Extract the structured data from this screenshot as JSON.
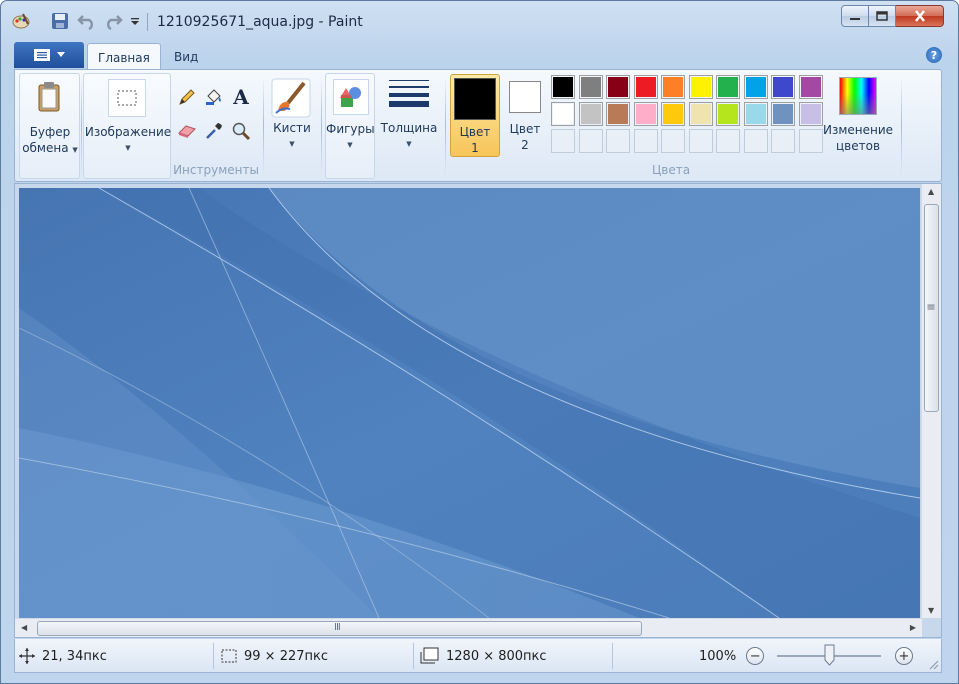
{
  "window": {
    "title": "1210925671_aqua.jpg - Paint",
    "controls": {
      "minimize": "minimize",
      "maximize": "maximize",
      "close": "close"
    }
  },
  "quick_access": {
    "icons": [
      "paint-app-icon",
      "save-icon",
      "undo-icon",
      "redo-icon",
      "customize-dropdown-icon"
    ]
  },
  "tabs": [
    {
      "label": "Главная",
      "active": true
    },
    {
      "label": "Вид",
      "active": false
    }
  ],
  "ribbon": {
    "clipboard": {
      "label_line1": "Буфер",
      "label_line2": "обмена"
    },
    "image": {
      "label": "Изображение"
    },
    "tools": {
      "group_label": "Инструменты",
      "text_tool_glyph": "A"
    },
    "brushes": {
      "label": "Кисти"
    },
    "shapes": {
      "label": "Фигуры"
    },
    "thickness": {
      "label": "Толщина"
    },
    "color1": {
      "label_line1": "Цвет",
      "label_line2": "1",
      "color": "#000000"
    },
    "color2": {
      "label_line1": "Цвет",
      "label_line2": "2",
      "color": "#ffffff"
    },
    "colors_group_label": "Цвета",
    "edit_colors": {
      "label_line1": "Изменение",
      "label_line2": "цветов"
    },
    "palette_row1": [
      "#000000",
      "#7f7f7f",
      "#880015",
      "#ed1c24",
      "#ff7f27",
      "#fff200",
      "#22b14c",
      "#00a2e8",
      "#3f48cc",
      "#a349a4"
    ],
    "palette_row2": [
      "#ffffff",
      "#c3c3c3",
      "#b97a57",
      "#ffaec9",
      "#ffc90e",
      "#efe4b0",
      "#b5e61d",
      "#99d9ea",
      "#7092be",
      "#c8bfe7"
    ],
    "palette_row3_empty_count": 10
  },
  "status": {
    "cursor_pos": "21, 34пкс",
    "selection_size": "99 × 227пкс",
    "image_size": "1280 × 800пкс",
    "zoom": "100%",
    "zoom_slider_fraction": 0.5
  },
  "colors": {
    "canvas_base": "#4a7dba",
    "accent": "#1f4f9c"
  }
}
